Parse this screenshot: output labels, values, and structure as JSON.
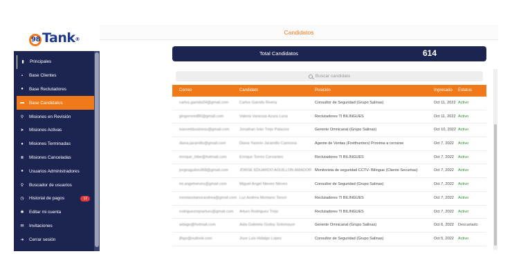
{
  "logo": {
    "prefix": "98",
    "text": "Tank",
    "reg": "®"
  },
  "sidebar": {
    "items": [
      {
        "label": "Principales",
        "icon": "bar-chart-icon"
      },
      {
        "label": "Base Clientes",
        "icon": "briefcase-icon"
      },
      {
        "label": "Base Reclutadores",
        "icon": "users-icon"
      },
      {
        "label": "Base Candidatos",
        "icon": "folder-icon",
        "active": true
      },
      {
        "label": "Misiones en Revisión",
        "icon": "search-icon"
      },
      {
        "label": "Misiones Activas",
        "icon": "rocket-icon"
      },
      {
        "label": "Misiones Terminadas",
        "icon": "user-check-icon"
      },
      {
        "label": "Misiones Canceladas",
        "icon": "cancel-icon"
      },
      {
        "label": "Usuarios Administradores",
        "icon": "admin-icon"
      },
      {
        "label": "Buscador de usuarios",
        "icon": "search-icon"
      },
      {
        "label": "Historial de pagos",
        "icon": "history-icon",
        "badge": "12"
      },
      {
        "label": "Editar mi cuenta",
        "icon": "gear-icon"
      },
      {
        "label": "Invitaciones",
        "icon": "mail-icon"
      },
      {
        "label": "Cerrar sesión",
        "icon": "logout-icon"
      }
    ]
  },
  "header": {
    "title": "Candidatos"
  },
  "summary": {
    "label": "Total Candidatos",
    "value": "614"
  },
  "search": {
    "placeholder": "Buscar candidato"
  },
  "table": {
    "columns": [
      "Correo",
      "Candidato",
      "Posición",
      "Ingresado",
      "Estatus"
    ],
    "rows": [
      [
        "carlos.garrido04@gmail.com",
        "Carlos Garrido Rivera",
        "Consultor de Seguridad (Grupo Salinas)",
        "Oct 11, 2022",
        "Activo"
      ],
      [
        "gingerreed80@gmail.com",
        "Valeria Vanessa Azura Luna",
        "Reclutadores TI BILINGUES",
        "Oct 11, 2022",
        "Activo"
      ],
      [
        "ivanvebbusiness@gmail.com",
        "Jonathan Iván Trejo Palacios",
        "Gerente Omnicanal (Grupo Salinas)",
        "Oct 10, 2022",
        "Activo"
      ],
      [
        "diana.jaramillo@gmail.com",
        "Diana Yasmin Jaramillo Carmona",
        "Agente de Ventas (Fretthunters) Proxima a cerrarse",
        "Oct 7, 2022",
        "Activo"
      ],
      [
        "enrique_tobe@hotmail.com",
        "Enrique Torres Cervantes",
        "Reclutadores TI BILINGUES",
        "Oct 7, 2022",
        "Activo"
      ],
      [
        "jorgeaguilon368@gmail.com",
        "JORGE EDUARDO AGUILLON AMADOR",
        "Monitorista de seguridad CCTV- Bilingue (Cliente Securitas)",
        "Oct 7, 2022",
        "Activo"
      ],
      [
        "mi.angelnieves@gmail.com",
        "Miguel Angel Nieves Nieves",
        "Consultor de Seguridad (Grupo Salinas)",
        "Oct 7, 2022",
        "Activo"
      ],
      [
        "montanotanorandrea@gmail.com",
        "Luz Andrea Montano Tanori",
        "Reclutadores TI BILINGUES",
        "Oct 7, 2022",
        "Activo"
      ],
      [
        "rodriguezrejoarturo@gmail.com",
        "Arturo Rodriguez Trejo",
        "Reclutadores TI BILINGUES",
        "Oct 7, 2022",
        "Activo"
      ],
      [
        "aidago@hotmail.com",
        "Aida Gabriela Godoy Sotomayor",
        "Gerente Omnicanal (Grupo Salinas)",
        "Oct 6, 2022",
        "Descartado"
      ],
      [
        "jlhgo@outlook.com",
        "Jose Luis Hidalgo Lopez",
        "Consultor de Seguridad (Grupo Salinas)",
        "Oct 5, 2022",
        "Activo"
      ]
    ]
  },
  "colors": {
    "accent": "#f07a1a",
    "navy": "#1c2552",
    "active_status": "#2e8b2e"
  }
}
